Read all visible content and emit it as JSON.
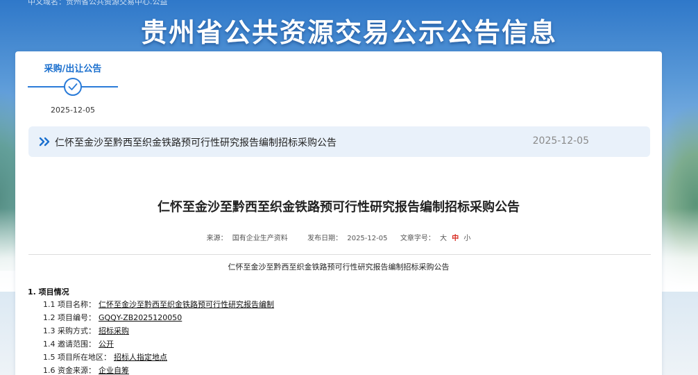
{
  "banner": {
    "top_strip": "中文域名：贵州省公共资源交易中心.公益",
    "title": "贵州省公共资源交易公示公告信息"
  },
  "step": {
    "label": "采购/出让公告",
    "date": "2025-12-05"
  },
  "notice": {
    "title": "仁怀至金沙至黔西至织金铁路预可行性研究报告编制招标采购公告",
    "date": "2025-12-05"
  },
  "article": {
    "title": "仁怀至金沙至黔西至织金铁路预可行性研究报告编制招标采购公告",
    "meta": {
      "source_label": "来源：",
      "source_value": "国有企业生产资料",
      "publish_label": "发布日期：",
      "publish_value": "2025-12-05",
      "fontsize_label": "文章字号：",
      "size_large": "大",
      "size_medium": "中",
      "size_small": "小"
    },
    "body_heading": "仁怀至金沙至黔西至织金铁路预可行性研究报告编制招标采购公告",
    "section_title": "1. 项目情况",
    "items": [
      {
        "label": "1.1 项目名称：",
        "value": "仁怀至金沙至黔西至织金铁路预可行性研究报告编制"
      },
      {
        "label": "1.2 项目编号：",
        "value": "GQQY-ZB2025120050"
      },
      {
        "label": "1.3 采购方式：",
        "value": "招标采购"
      },
      {
        "label": "1.4 邀请范围：",
        "value": "公开"
      },
      {
        "label": "1.5 项目所在地区：",
        "value": "招标人指定地点"
      },
      {
        "label": "1.6 资金来源：",
        "value": "企业自筹"
      }
    ]
  },
  "colors": {
    "accent": "#1a6fce",
    "highlight_red": "#d8261c",
    "notice_bg": "#e9f1fa"
  },
  "icons": {
    "step": "check-circle-icon",
    "notice": "double-chevron-right-icon"
  }
}
